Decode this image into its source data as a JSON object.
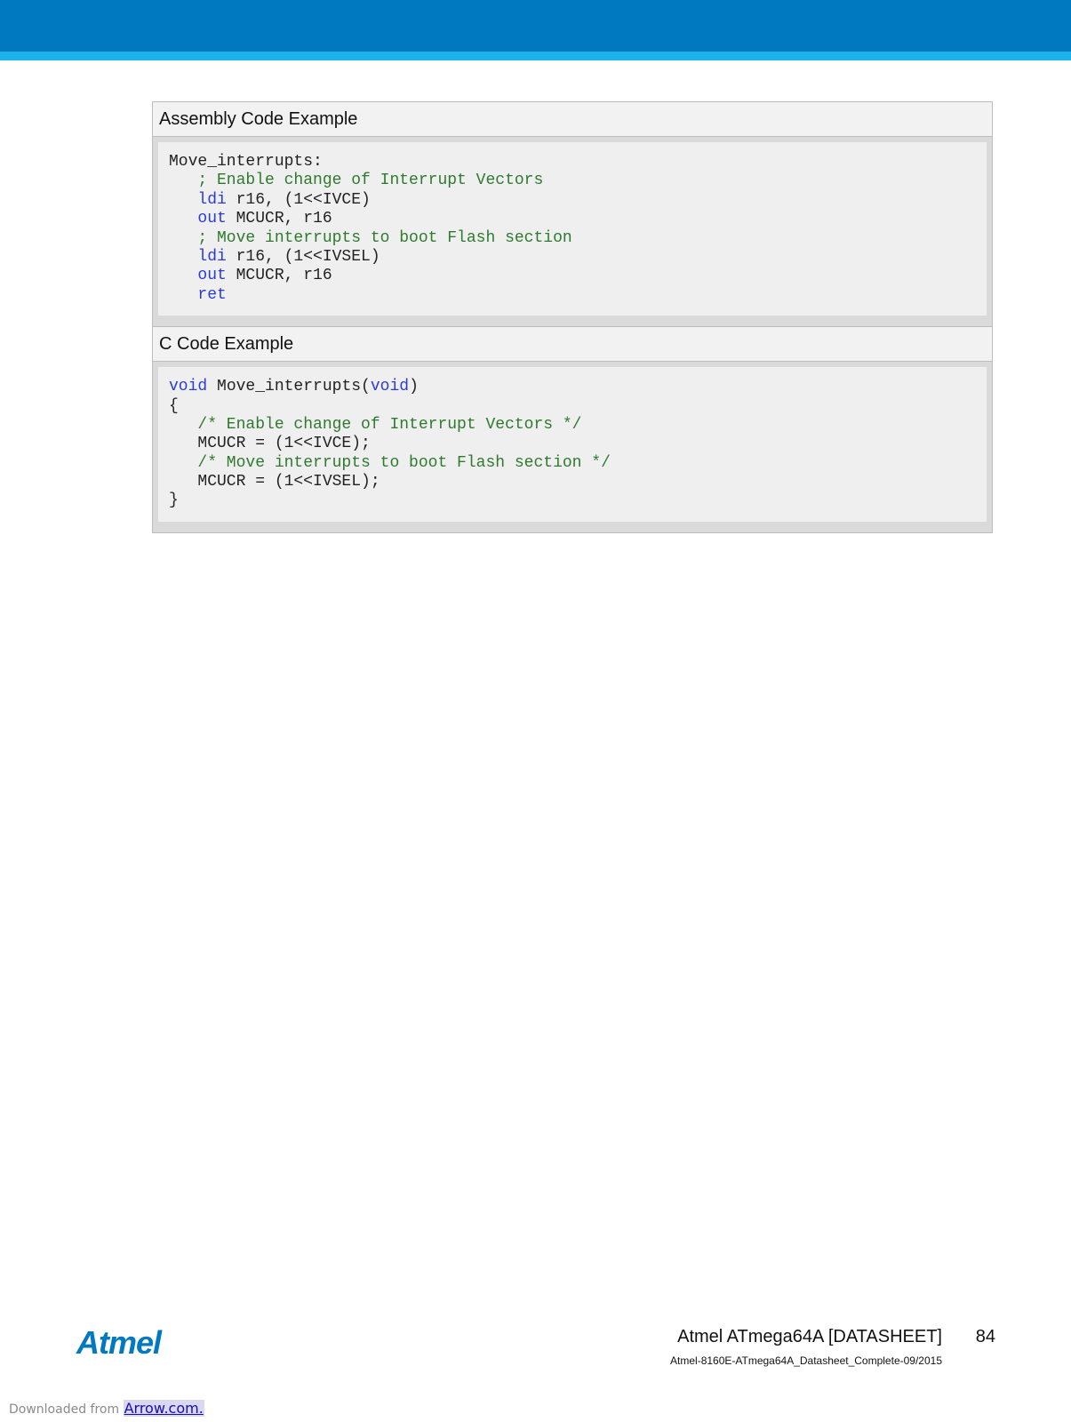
{
  "header": {
    "bar_color": "#0079c1",
    "stripe_color": "#1bb3ea"
  },
  "sections": [
    {
      "title": "Assembly Code Example",
      "lines": [
        [
          {
            "t": "Move_interrupts:",
            "c": "pl"
          }
        ],
        [
          {
            "t": "   ",
            "c": "pl"
          },
          {
            "t": "; Enable change of Interrupt Vectors",
            "c": "cm"
          }
        ],
        [
          {
            "t": "   ",
            "c": "pl"
          },
          {
            "t": "ldi",
            "c": "kw"
          },
          {
            "t": " r16, (1<<IVCE)",
            "c": "pl"
          }
        ],
        [
          {
            "t": "   ",
            "c": "pl"
          },
          {
            "t": "out",
            "c": "kw"
          },
          {
            "t": " MCUCR, r16",
            "c": "pl"
          }
        ],
        [
          {
            "t": "   ",
            "c": "pl"
          },
          {
            "t": "; Move interrupts to boot Flash section",
            "c": "cm"
          }
        ],
        [
          {
            "t": "   ",
            "c": "pl"
          },
          {
            "t": "ldi",
            "c": "kw"
          },
          {
            "t": " r16, (1<<IVSEL)",
            "c": "pl"
          }
        ],
        [
          {
            "t": "   ",
            "c": "pl"
          },
          {
            "t": "out",
            "c": "kw"
          },
          {
            "t": " MCUCR, r16",
            "c": "pl"
          }
        ],
        [
          {
            "t": "   ",
            "c": "pl"
          },
          {
            "t": "ret",
            "c": "kw"
          }
        ]
      ]
    },
    {
      "title": "C Code Example",
      "lines": [
        [
          {
            "t": "void",
            "c": "kw"
          },
          {
            "t": " Move_interrupts(",
            "c": "pl"
          },
          {
            "t": "void",
            "c": "kw"
          },
          {
            "t": ")",
            "c": "pl"
          }
        ],
        [
          {
            "t": "{",
            "c": "pl"
          }
        ],
        [
          {
            "t": "   ",
            "c": "pl"
          },
          {
            "t": "/* Enable change of Interrupt Vectors */",
            "c": "cm"
          }
        ],
        [
          {
            "t": "   MCUCR = (1<<IVCE);",
            "c": "pl"
          }
        ],
        [
          {
            "t": "   ",
            "c": "pl"
          },
          {
            "t": "/* Move interrupts to boot Flash section */",
            "c": "cm"
          }
        ],
        [
          {
            "t": "   MCUCR = (1<<IVSEL);",
            "c": "pl"
          }
        ],
        [
          {
            "t": "}",
            "c": "pl"
          }
        ]
      ]
    }
  ],
  "footer": {
    "logo_text": "Atmel",
    "doc_title": "Atmel ATmega64A [DATASHEET]",
    "page_number": "84",
    "doc_id": "Atmel-8160E-ATmega64A_Datasheet_Complete-09/2015",
    "brand_color": "#0079c1"
  },
  "download": {
    "prefix": "Downloaded from ",
    "link_text": "Arrow.com."
  }
}
